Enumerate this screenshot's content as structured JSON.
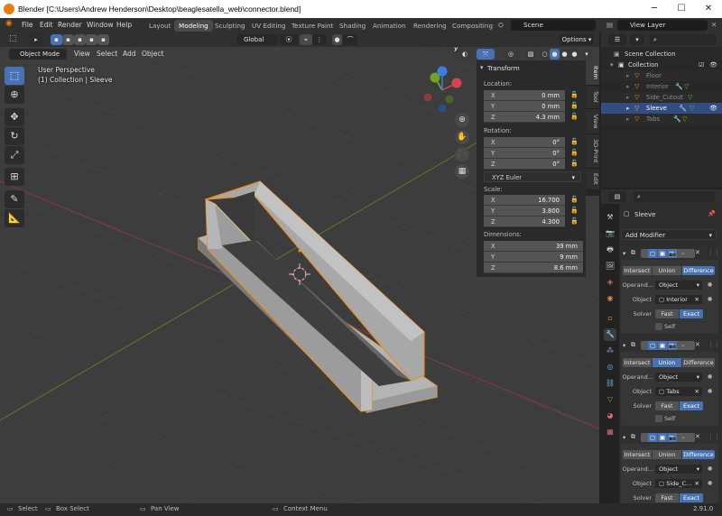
{
  "window": {
    "title": "Blender [C:\\Users\\Andrew Henderson\\Desktop\\beaglesatella_web\\connector.blend]",
    "minimize": "─",
    "maximize": "☐",
    "close": "✕"
  },
  "menu": {
    "file": "File",
    "edit": "Edit",
    "render": "Render",
    "window": "Window",
    "help": "Help"
  },
  "workspaces": [
    "Layout",
    "Modeling",
    "Sculpting",
    "UV Editing",
    "Texture Paint",
    "Shading",
    "Animation",
    "Rendering",
    "Compositing"
  ],
  "active_workspace": "Modeling",
  "scene": {
    "name": "Scene",
    "view_layer": "View Layer"
  },
  "viewport_header": {
    "mode": "Object Mode",
    "view": "View",
    "select": "Select",
    "add": "Add",
    "object": "Object",
    "orientation": "Global",
    "options": "Options"
  },
  "viewport_overlay": {
    "perspective": "User Perspective",
    "collection": "(1) Collection | Sleeve"
  },
  "gizmo": {
    "x": "X",
    "y": "Y",
    "z": "Z"
  },
  "n_panel": {
    "header": "Transform",
    "location_label": "Location:",
    "location": [
      {
        "axis": "X",
        "value": "0 mm"
      },
      {
        "axis": "Y",
        "value": "0 mm"
      },
      {
        "axis": "Z",
        "value": "4.3 mm"
      }
    ],
    "rotation_label": "Rotation:",
    "rotation": [
      {
        "axis": "X",
        "value": "0°"
      },
      {
        "axis": "Y",
        "value": "0°"
      },
      {
        "axis": "Z",
        "value": "0°"
      }
    ],
    "rotation_mode": "XYZ Euler",
    "scale_label": "Scale:",
    "scale": [
      {
        "axis": "X",
        "value": "16.700"
      },
      {
        "axis": "Y",
        "value": "3.800"
      },
      {
        "axis": "Z",
        "value": "4.300"
      }
    ],
    "dimensions_label": "Dimensions:",
    "dimensions": [
      {
        "axis": "X",
        "value": "39 mm"
      },
      {
        "axis": "Y",
        "value": "9 mm"
      },
      {
        "axis": "Z",
        "value": "8.6 mm"
      }
    ],
    "tabs": [
      "Item",
      "Tool",
      "View",
      "3D-Print",
      "Edit"
    ]
  },
  "outliner": {
    "scene_collection": "Scene Collection",
    "collection": "Collection",
    "items": [
      {
        "name": "Floor",
        "selected": false,
        "dim": true
      },
      {
        "name": "Interior",
        "selected": false,
        "dim": true
      },
      {
        "name": "Side_Cutout",
        "selected": false,
        "dim": true
      },
      {
        "name": "Sleeve",
        "selected": true,
        "dim": false
      },
      {
        "name": "Tabs",
        "selected": false,
        "dim": true
      }
    ]
  },
  "properties": {
    "object_name": "Sleeve",
    "add_modifier": "Add Modifier",
    "modifiers": [
      {
        "ops": [
          "Intersect",
          "Union",
          "Difference"
        ],
        "active_op": "Difference",
        "operand_label": "Operand...",
        "operand_value": "Object",
        "object_label": "Object",
        "object_value": "Interior",
        "solver_label": "Solver",
        "solvers": [
          "Fast",
          "Exact"
        ],
        "active_solver": "Exact",
        "self_label": "Self"
      },
      {
        "ops": [
          "Intersect",
          "Union",
          "Difference"
        ],
        "active_op": "Union",
        "operand_label": "Operand...",
        "operand_value": "Object",
        "object_label": "Object",
        "object_value": "Tabs",
        "solver_label": "Solver",
        "solvers": [
          "Fast",
          "Exact"
        ],
        "active_solver": "Exact",
        "self_label": "Self"
      },
      {
        "ops": [
          "Intersect",
          "Union",
          "Difference"
        ],
        "active_op": "Difference",
        "operand_label": "Operand...",
        "operand_value": "Object",
        "object_label": "Object",
        "object_value": "Side_C...",
        "solver_label": "Solver",
        "solvers": [
          "Fast",
          "Exact"
        ],
        "active_solver": "Exact"
      }
    ]
  },
  "status_bar": {
    "select": "Select",
    "box_select": "Box Select",
    "pan_view": "Pan View",
    "context_menu": "Context Menu",
    "version": "2.91.0"
  },
  "colors": {
    "accent_blue": "#4772b3",
    "selection_orange": "#e8901c",
    "x_axis": "#d9434b",
    "y_axis": "#7ab32a",
    "z_axis": "#3b7de0"
  }
}
